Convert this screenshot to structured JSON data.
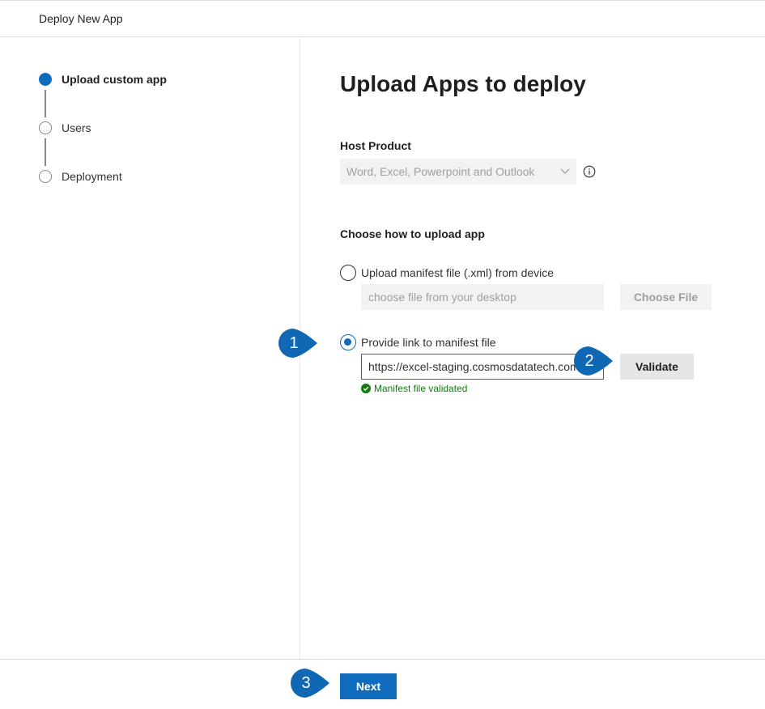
{
  "header": {
    "title": "Deploy New App"
  },
  "steps": [
    {
      "label": "Upload custom app",
      "active": true
    },
    {
      "label": "Users",
      "active": false
    },
    {
      "label": "Deployment",
      "active": false
    }
  ],
  "main": {
    "title": "Upload Apps to deploy",
    "host_product": {
      "label": "Host Product",
      "selected": "Word, Excel, Powerpoint and Outlook",
      "info_icon": "info-icon"
    },
    "upload_method": {
      "label": "Choose how to upload app",
      "option_file": {
        "label": "Upload manifest file (.xml) from device",
        "placeholder": "choose file from your desktop",
        "button": "Choose File"
      },
      "option_link": {
        "label": "Provide link to manifest file",
        "value": "https://excel-staging.cosmosdatatech.com",
        "button": "Validate",
        "status": "Manifest file validated"
      }
    }
  },
  "footer": {
    "next_label": "Next"
  },
  "callouts": [
    "1",
    "2",
    "3"
  ],
  "colors": {
    "accent": "#0f6cbd",
    "callout": "#1068b4",
    "success": "#107c10"
  }
}
